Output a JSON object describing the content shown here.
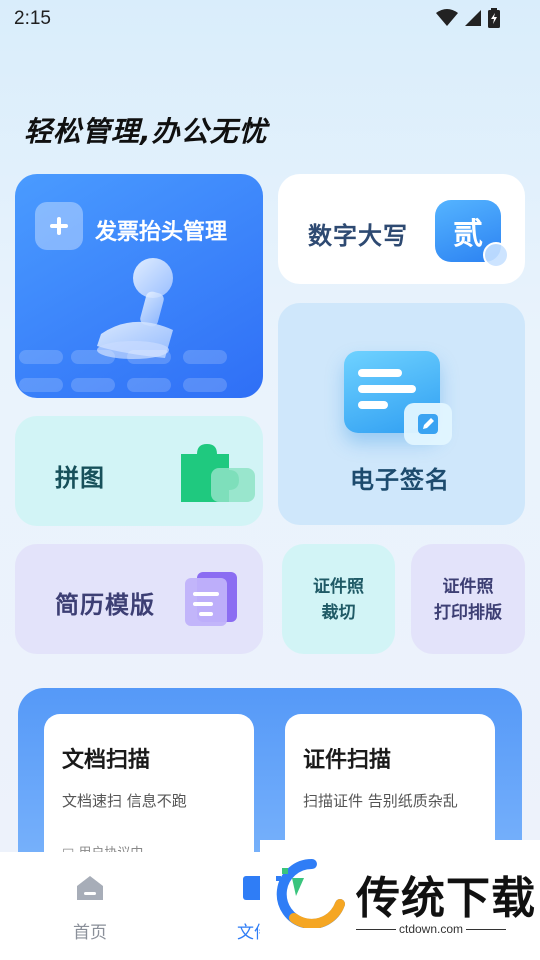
{
  "status_bar": {
    "time": "2:15",
    "icons": [
      "wifi-icon",
      "cell-signal-icon",
      "battery-charging-icon"
    ]
  },
  "headline": "轻松管理,办公无忧",
  "cards": {
    "invoice_header": {
      "title": "发票抬头管理",
      "icon": "plus-icon"
    },
    "number_capital": {
      "title": "数字大写",
      "badge": "贰"
    },
    "e_signature": {
      "title": "电子签名"
    },
    "puzzle": {
      "title": "拼图"
    },
    "resume_template": {
      "title": "简历模版"
    },
    "id_photo_crop": {
      "line1": "证件照",
      "line2": "裁切"
    },
    "id_photo_print": {
      "line1": "证件照",
      "line2": "打印排版"
    }
  },
  "scan": {
    "document": {
      "title": "文档扫描",
      "subtitle": "文档速扫 信息不跑",
      "extra": "□ 用户协议中"
    },
    "certificate": {
      "title": "证件扫描",
      "subtitle": "扫描证件 告别纸质杂乱"
    }
  },
  "bottom_nav": {
    "home": {
      "label": "首页"
    },
    "files": {
      "label": "文件"
    }
  },
  "watermark": {
    "brand": "传统下载",
    "url": "ctdown.com"
  },
  "colors": {
    "accent": "#2f7df6",
    "invoice_card": "#3a82f8",
    "esign_card": "#cfe7fb",
    "puzzle_card": "#d2f4f6",
    "resume_card": "#e3e3fa"
  }
}
